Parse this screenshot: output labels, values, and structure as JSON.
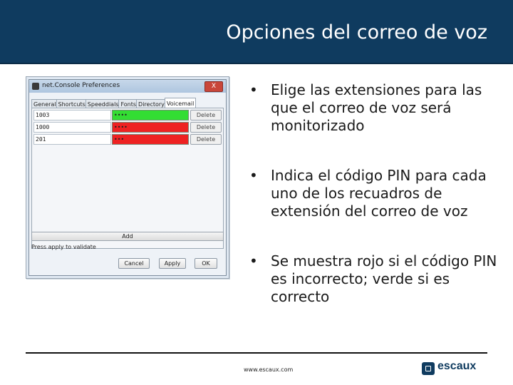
{
  "slide": {
    "title": "Opciones del correo de voz",
    "footer_url": "www.escaux.com",
    "logo_text": "escaux",
    "brand_color": "#0f3b5f"
  },
  "window": {
    "title": "net.Console Preferences",
    "close_label": "X",
    "tabs": [
      "General",
      "Shortcuts",
      "Speeddials",
      "Fonts",
      "Directory",
      "Voicemail"
    ],
    "active_tab": "Voicemail",
    "rows": [
      {
        "extension": "1003",
        "pin": "••••",
        "pin_status": "valid",
        "pin_color": "#33dd33",
        "delete_label": "Delete"
      },
      {
        "extension": "1000",
        "pin": "••••",
        "pin_status": "invalid",
        "pin_color": "#ee2222",
        "delete_label": "Delete"
      },
      {
        "extension": "201",
        "pin": "•••",
        "pin_status": "invalid",
        "pin_color": "#ee2222",
        "delete_label": "Delete"
      }
    ],
    "add_label": "Add",
    "status_text": "Press apply to validate",
    "buttons": {
      "cancel": "Cancel",
      "apply": "Apply",
      "ok": "OK"
    }
  },
  "bullets": [
    "Elige las extensiones para las que el correo de voz será monitorizado",
    "Indica el código PIN para cada uno de los recuadros de extensión del correo de voz",
    "Se muestra rojo si el código PIN es incorrecto; verde si es correcto"
  ],
  "bullet_symbol": "•"
}
